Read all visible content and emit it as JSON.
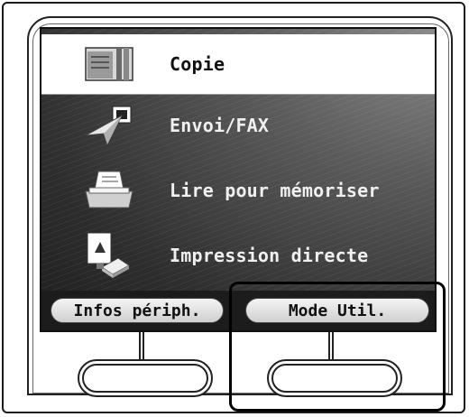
{
  "menu": {
    "items": [
      {
        "label": "Copie",
        "icon": "copy-icon",
        "selected": true
      },
      {
        "label": "Envoi/FAX",
        "icon": "send-fax-icon",
        "selected": false
      },
      {
        "label": "Lire pour mémoriser",
        "icon": "scan-store-icon",
        "selected": false
      },
      {
        "label": "Impression directe",
        "icon": "direct-print-icon",
        "selected": false
      }
    ]
  },
  "softkeys": {
    "left_label": "Infos périph.",
    "right_label": "Mode Util."
  },
  "colors": {
    "screen_dark": "#2e2e2e",
    "selected_bg": "#ffffff",
    "softkey_bar": "#1c1c1c"
  }
}
